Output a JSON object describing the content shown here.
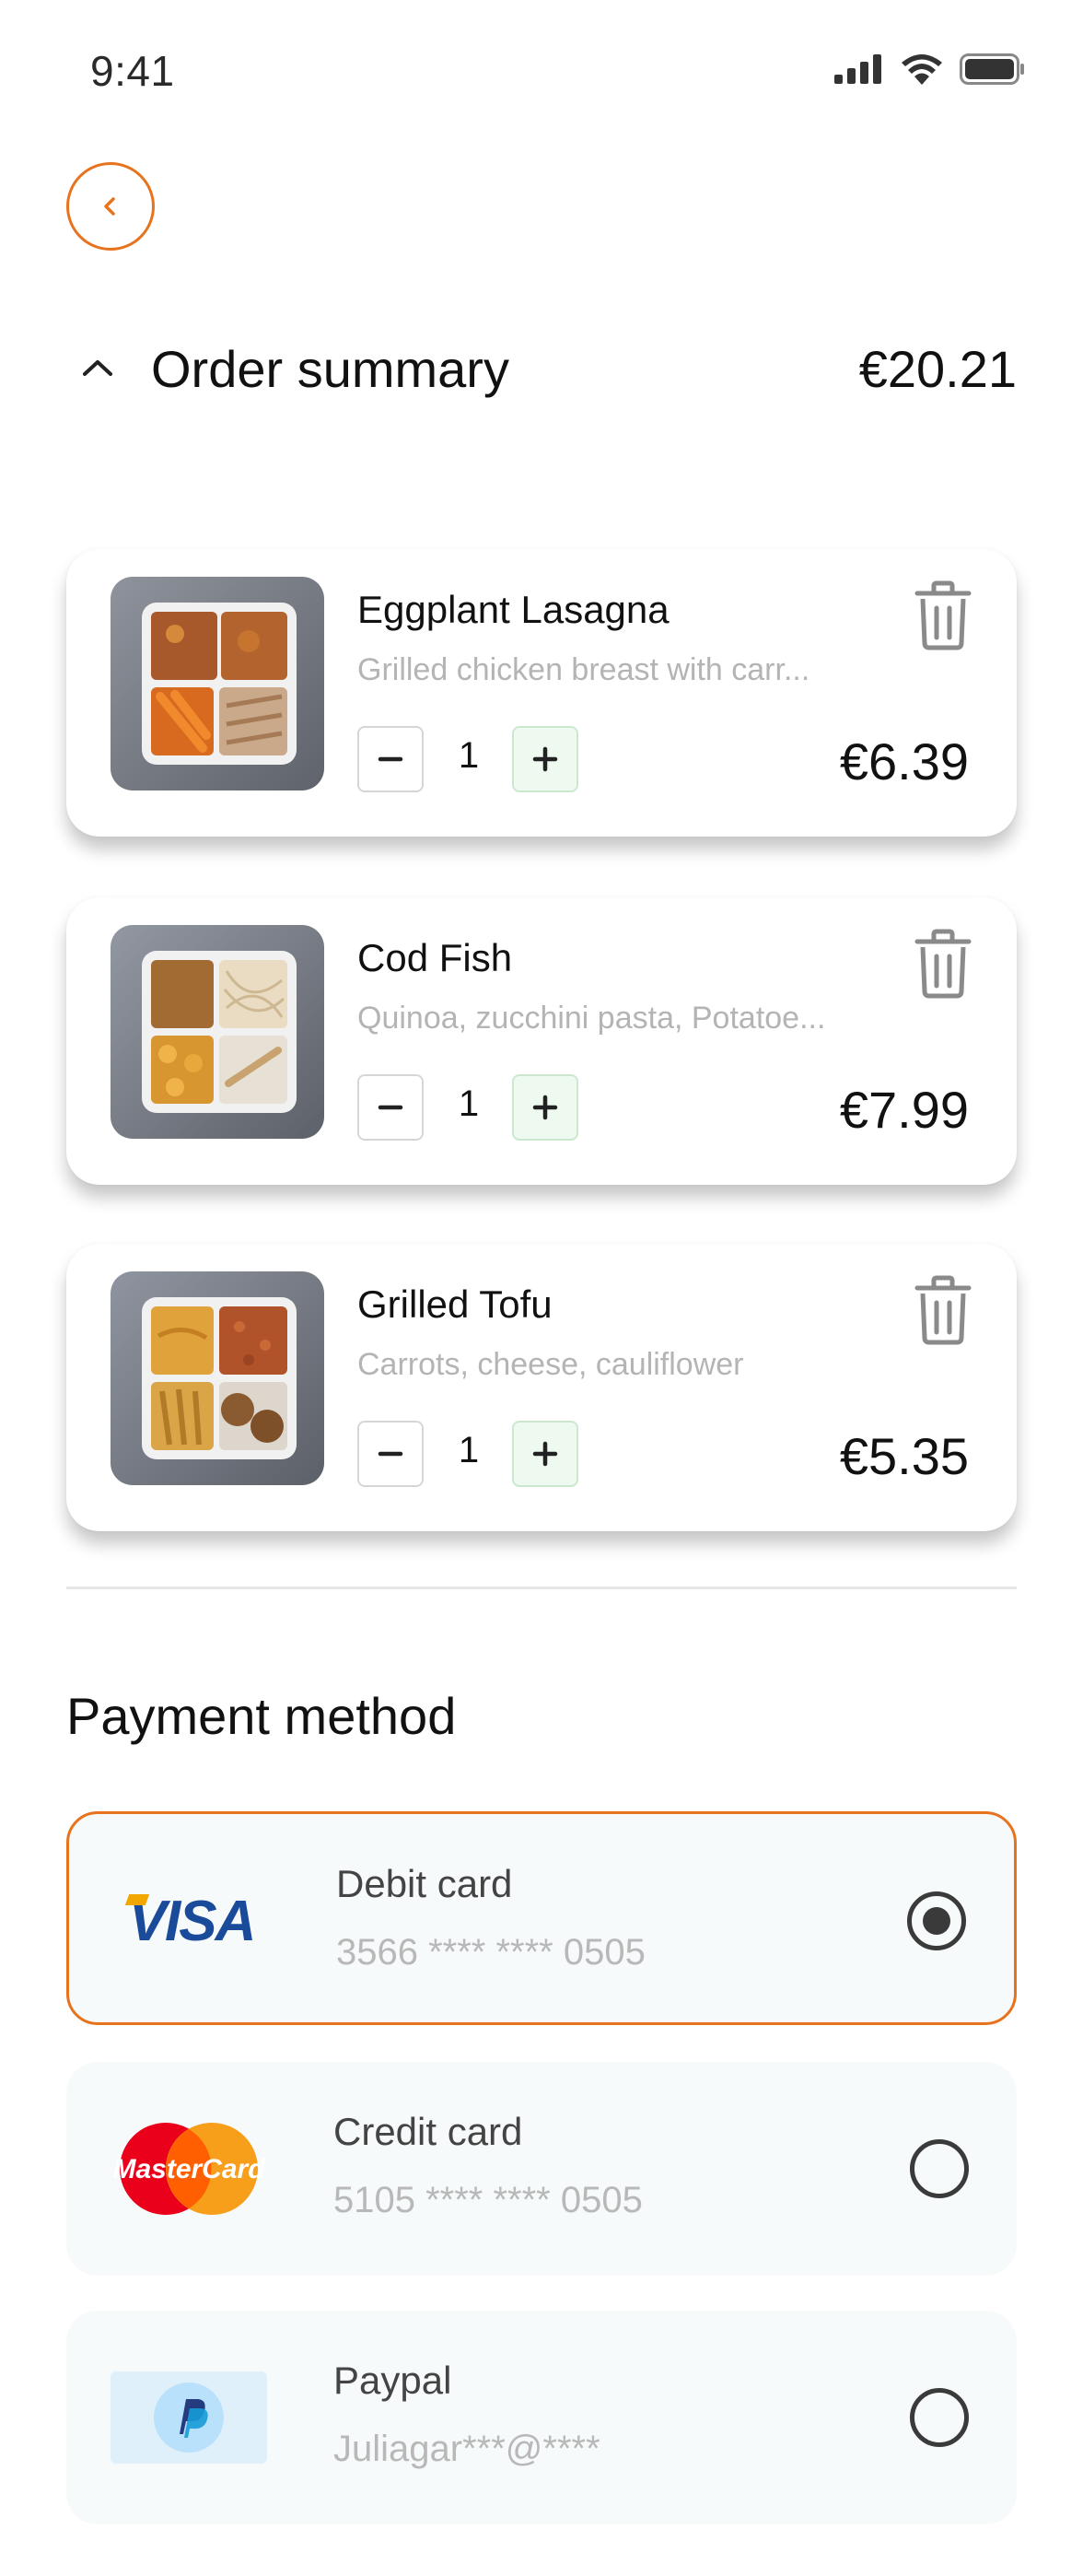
{
  "status_bar": {
    "time": "9:41"
  },
  "order_summary": {
    "title": "Order summary",
    "total": "€20.21"
  },
  "items": [
    {
      "name": "Eggplant Lasagna",
      "description": "Grilled chicken breast with carr...",
      "quantity": "1",
      "price": "€6.39"
    },
    {
      "name": "Cod Fish",
      "description": "Quinoa, zucchini pasta, Potatoe...",
      "quantity": "1",
      "price": "€7.99"
    },
    {
      "name": "Grilled Tofu",
      "description": "Carrots, cheese, cauliflower",
      "quantity": "1",
      "price": "€5.35"
    }
  ],
  "payment": {
    "title": "Payment method",
    "options": [
      {
        "brand": "VISA",
        "label": "Debit card",
        "detail": "3566 **** **** 0505",
        "selected": true
      },
      {
        "brand": "MasterCard",
        "label": "Credit card",
        "detail": "5105 **** **** 0505",
        "selected": false
      },
      {
        "brand": "PayPal",
        "label": "Paypal",
        "detail": "Juliagar***@****",
        "selected": false
      }
    ]
  },
  "colors": {
    "accent": "#e8731f",
    "plus_bg": "#eefaf0",
    "card_bg": "#f7fafb",
    "muted_text": "#b4b4b4"
  }
}
